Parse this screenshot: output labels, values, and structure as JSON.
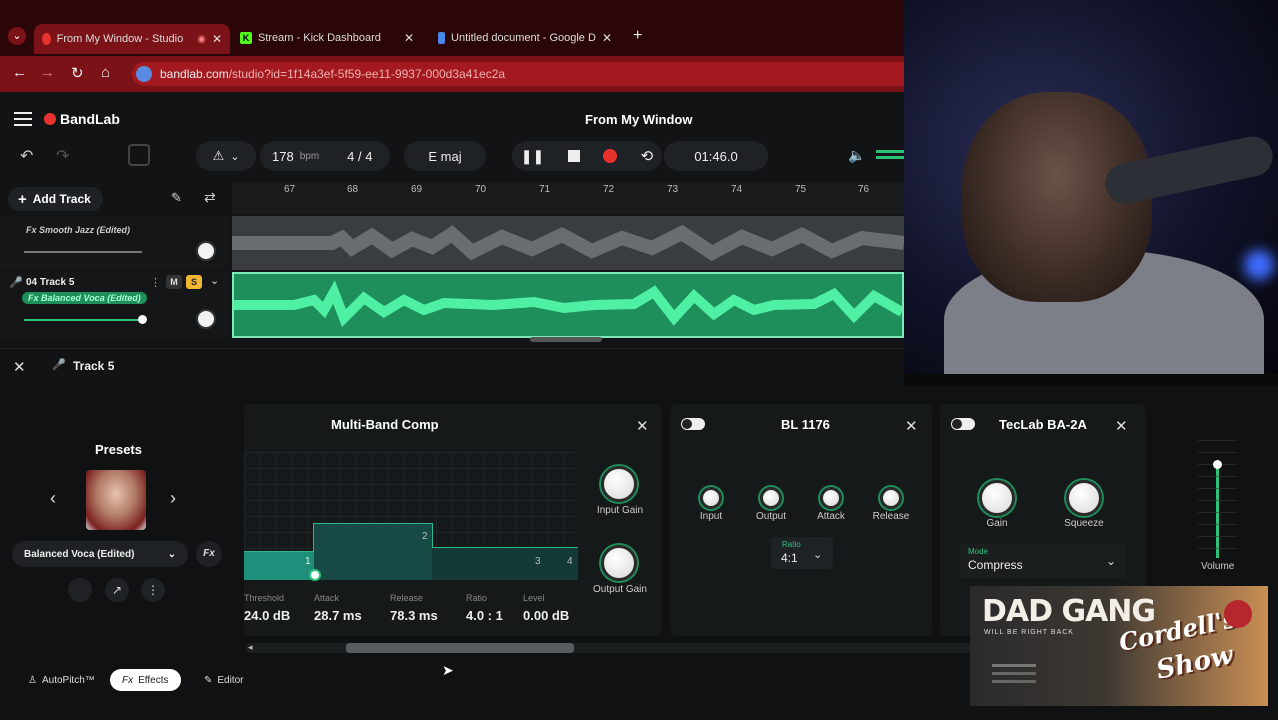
{
  "browser": {
    "tabs": [
      {
        "title": "From My Window - Studio",
        "active": true
      },
      {
        "title": "Stream - Kick Dashboard",
        "active": false
      },
      {
        "title": "Untitled document - Google D",
        "active": false
      }
    ],
    "new_tab": "+",
    "url_host": "bandlab.com",
    "url_path": "/studio?id=1f14a3ef-5f59-ee11-9937-000d3a41ec2a"
  },
  "app": {
    "logo": "BandLab",
    "project_title": "From My Window",
    "tempo": "178",
    "tempo_unit": "bpm",
    "time_signature": "4 / 4",
    "key": "E maj",
    "time": "01:46.0",
    "add_track": "Add Track",
    "ruler": [
      "67",
      "68",
      "69",
      "70",
      "71",
      "72",
      "73",
      "74",
      "75",
      "76"
    ],
    "tracks": [
      {
        "fx": "Fx Smooth Jazz (Edited)"
      },
      {
        "name": "04  Track 5",
        "fx": "Fx Balanced Voca (Edited)",
        "mute": "M",
        "solo": "S"
      }
    ]
  },
  "panel": {
    "track_name": "Track 5",
    "presets_title": "Presets",
    "preset_name": "Balanced Voca (Edited)",
    "fx_button": "Fx",
    "multiband": {
      "title": "Multi-Band Comp",
      "bands": [
        "1",
        "2",
        "3",
        "4"
      ],
      "params": [
        {
          "label": "Threshold",
          "value": "24.0 dB"
        },
        {
          "label": "Attack",
          "value": "28.7 ms"
        },
        {
          "label": "Release",
          "value": "78.3 ms"
        },
        {
          "label": "Ratio",
          "value": "4.0 : 1"
        },
        {
          "label": "Level",
          "value": "0.00 dB"
        }
      ],
      "knobs": [
        "Input Gain",
        "Output Gain"
      ]
    },
    "bl1176": {
      "title": "BL 1176",
      "knobs": [
        "Input",
        "Output",
        "Attack",
        "Release"
      ],
      "ratio_label": "Ratio",
      "ratio_value": "4:1"
    },
    "ba2a": {
      "title": "TecLab BA-2A",
      "knobs": [
        "Gain",
        "Squeeze"
      ],
      "mode_label": "Mode",
      "mode_value": "Compress"
    },
    "volume_label": "Volume",
    "bottom_tabs": [
      "AutoPitch™",
      "Effects",
      "Editor"
    ]
  },
  "overlay": {
    "title": "DAD GANG",
    "subtitle": "WILL BE RIGHT BACK",
    "show_line1": "Cordell's",
    "show_line2": "Show"
  }
}
